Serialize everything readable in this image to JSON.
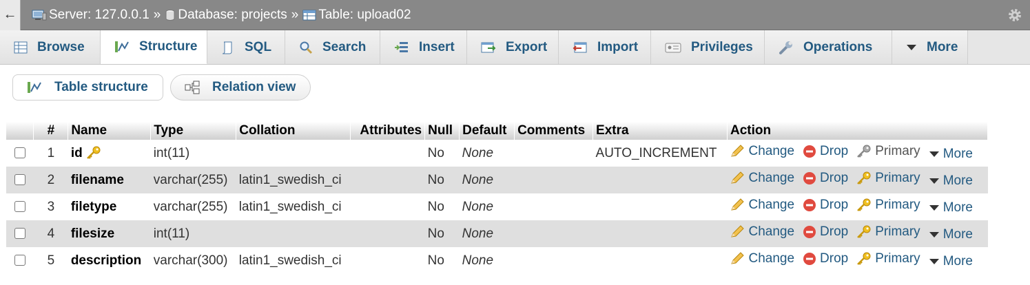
{
  "breadcrumb": {
    "server": "Server: 127.0.0.1",
    "database": "Database: projects",
    "table": "Table: upload02",
    "separator": "»"
  },
  "tabs": [
    {
      "label": "Browse",
      "icon": "browse-icon"
    },
    {
      "label": "Structure",
      "icon": "structure-icon",
      "active": true
    },
    {
      "label": "SQL",
      "icon": "sql-icon"
    },
    {
      "label": "Search",
      "icon": "search-icon"
    },
    {
      "label": "Insert",
      "icon": "insert-icon"
    },
    {
      "label": "Export",
      "icon": "export-icon"
    },
    {
      "label": "Import",
      "icon": "import-icon"
    },
    {
      "label": "Privileges",
      "icon": "privileges-icon"
    },
    {
      "label": "Operations",
      "icon": "wrench-icon"
    },
    {
      "label": "More",
      "icon": "caret-down-icon"
    }
  ],
  "subnav": {
    "table_structure": "Table structure",
    "relation_view": "Relation view"
  },
  "columns": [
    "#",
    "Name",
    "Type",
    "Collation",
    "Attributes",
    "Null",
    "Default",
    "Comments",
    "Extra",
    "Action"
  ],
  "rows": [
    {
      "num": "1",
      "name": "id",
      "primary_key": true,
      "type": "int(11)",
      "collation": "",
      "attributes": "",
      "null": "No",
      "default": "None",
      "comments": "",
      "extra": "AUTO_INCREMENT"
    },
    {
      "num": "2",
      "name": "filename",
      "primary_key": false,
      "type": "varchar(255)",
      "collation": "latin1_swedish_ci",
      "attributes": "",
      "null": "No",
      "default": "None",
      "comments": "",
      "extra": ""
    },
    {
      "num": "3",
      "name": "filetype",
      "primary_key": false,
      "type": "varchar(255)",
      "collation": "latin1_swedish_ci",
      "attributes": "",
      "null": "No",
      "default": "None",
      "comments": "",
      "extra": ""
    },
    {
      "num": "4",
      "name": "filesize",
      "primary_key": false,
      "type": "int(11)",
      "collation": "",
      "attributes": "",
      "null": "No",
      "default": "None",
      "comments": "",
      "extra": ""
    },
    {
      "num": "5",
      "name": "description",
      "primary_key": false,
      "type": "varchar(300)",
      "collation": "latin1_swedish_ci",
      "attributes": "",
      "null": "No",
      "default": "None",
      "comments": "",
      "extra": ""
    }
  ],
  "actions": {
    "change": "Change",
    "drop": "Drop",
    "primary": "Primary",
    "more": "More"
  },
  "colors": {
    "link": "#235a81",
    "topbar": "#888888",
    "row_alt": "#dfdfdf"
  }
}
